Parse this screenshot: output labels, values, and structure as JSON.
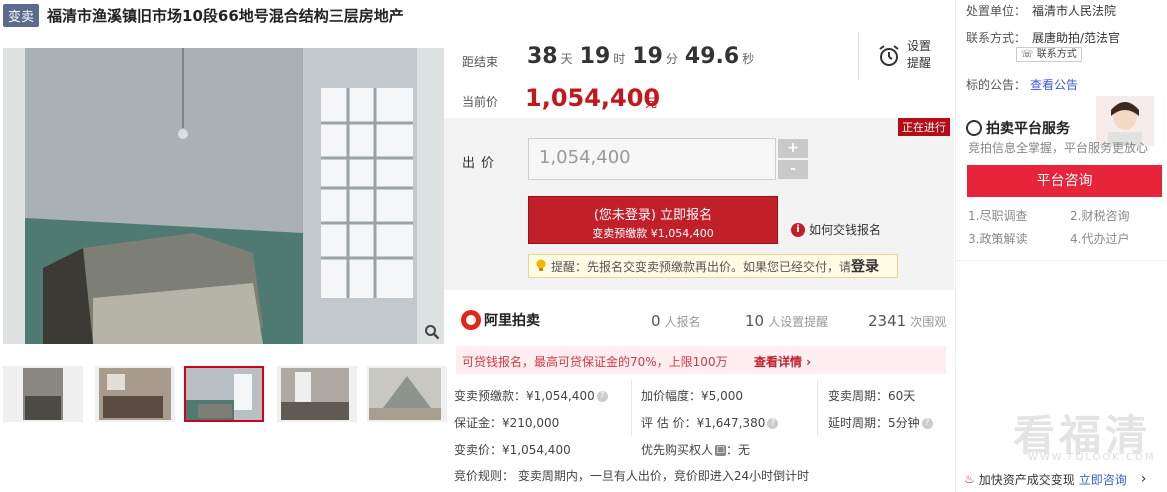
{
  "header": {
    "tag": "变卖",
    "title": "福清市渔溪镇旧市场10段66地号混合结构三层房地产"
  },
  "countdown": {
    "label": "距结束",
    "days": "38",
    "days_unit": "天",
    "hours": "19",
    "hours_unit": "时",
    "minutes": "19",
    "minutes_unit": "分",
    "seconds": "49.6",
    "seconds_unit": "秒"
  },
  "price": {
    "label": "当前价",
    "value": "1,054,400",
    "unit": "元"
  },
  "remind": {
    "label": "设置提醒"
  },
  "bid": {
    "status": "正在进行",
    "label": "出价",
    "input_value": "1,054,400",
    "plus": "+",
    "minus": "-",
    "signup_main": "(您未登录) 立即报名",
    "signup_sub": "变卖预缴款 ¥1,054,400",
    "howto": "如何交钱报名",
    "tip_text": "提醒：先报名交变卖预缴款再出价。如果您已经交付，请",
    "tip_login": "登录"
  },
  "stats": {
    "logo": "阿里拍卖",
    "signups": "0",
    "signups_label": "人报名",
    "reminders": "10",
    "reminders_label": "人设置提醒",
    "views": "2341",
    "views_label": "次围观"
  },
  "loan": {
    "text": "可贷钱报名，最高可贷保证金的70%，上限100万",
    "link": "查看详情 ›"
  },
  "info": {
    "deposit_pre": "变卖预缴款：¥1,054,400",
    "increment": "加价幅度：¥5,000",
    "period": "变卖周期：60天",
    "guarantee": "保证金：¥210,000",
    "appraisal": "评 估 价：¥1,647,380",
    "delay": "延时周期：5分钟",
    "sell_price": "变卖价：¥1,054,400",
    "priority": "优先购买权人",
    "priority_val": "：无",
    "rules_label": "竞价规则：",
    "rules_text": "变卖周期内，一旦有人出价，竞价即进入24小时倒计时"
  },
  "sidebar": {
    "court_label": "处置单位：",
    "court": "福清市人民法院",
    "contact_label": "联系方式：",
    "contact": "展唐助拍/范法官",
    "contact_btn": "联系方式",
    "notice_label": "标的公告：",
    "notice_link": "查看公告",
    "service_title": "拍卖平台服务",
    "service_sub": "竞拍信息全掌握，平台服务更放心",
    "consult": "平台咨询",
    "items": [
      "1.尽职调查",
      "2.财税咨询",
      "3.政策解读",
      "4.代办过户"
    ],
    "bottom_text": "加快资产成交变现",
    "bottom_link": "立即咨询",
    "bottom_arrow": "›"
  },
  "watermark": {
    "text": "看福清",
    "url": "WWW.FQLOOK.COM"
  },
  "colors": {
    "brand_red": "#c11f2a",
    "price_red": "#c4171c",
    "tag_blue": "#5a6b8c"
  }
}
